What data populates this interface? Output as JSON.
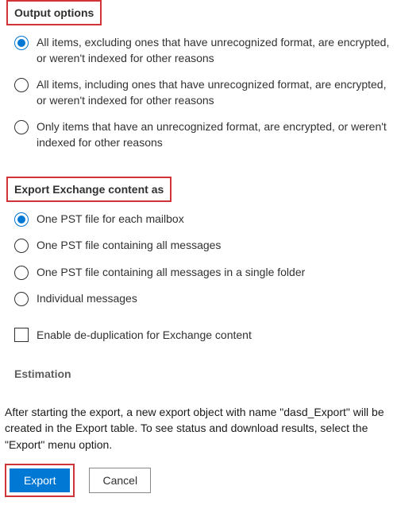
{
  "output_options": {
    "title": "Output options",
    "items": [
      "All items, excluding ones that have unrecognized format, are encrypted, or weren't indexed for other reasons",
      "All items, including ones that have unrecognized format, are encrypted, or weren't indexed for other reasons",
      "Only items that have an unrecognized format, are encrypted, or weren't indexed for other reasons"
    ],
    "selected": 0
  },
  "export_as": {
    "title": "Export Exchange content as",
    "items": [
      "One PST file for each mailbox",
      "One PST file containing all messages",
      "One PST file containing all messages in a single folder",
      "Individual messages"
    ],
    "selected": 0
  },
  "dedup": {
    "label": "Enable de-duplication for Exchange content",
    "checked": false
  },
  "estimation_label": "Estimation",
  "info_text": "After starting the export, a new export object with name \"dasd_Export\" will be created in the Export table. To see status and download results, select the \"Export\" menu option.",
  "buttons": {
    "export": "Export",
    "cancel": "Cancel"
  }
}
